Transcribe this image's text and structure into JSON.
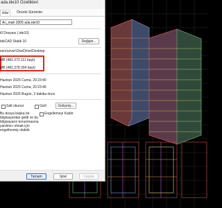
{
  "dialog": {
    "title": "ada.ide10 Özellikleri",
    "tabs": [
      "ıklar",
      "Önceki Sürümler"
    ],
    "file_name": "Ac_mah 3305 ada.ide10",
    "type_value": "i0 Dosyası (.ide10)",
    "opens_with": "ideCAD Statik 10",
    "change_button": "Değiştir...",
    "location": "sers\\urver\\OneDrive\\Desktop",
    "size": "MB (481.372.111 bayt)",
    "size_on_disk": "MB (481.378.304 bayt)",
    "created": "Haziran 2025 Cuma, 20:23:40",
    "modified": "Haziran 2025 Cuma, 20:23:46",
    "accessed": "Haziran 2025 Bugün, 2 dakika önce",
    "attr_readonly": "Salt okunur",
    "attr_hidden": "Gizli",
    "advanced_button": "Gelişmiş...",
    "security_text": [
      "Bu dosya başka bir",
      "bilgisayardan geldi ve bu",
      "bilgisayarın korunmasına",
      "yardımcı olmak için",
      "engellenmiş olabilir."
    ],
    "unblock_label": "Engellemeyi Kaldır",
    "ok_button": "Tamam",
    "cancel_button": "İptal",
    "apply_button": "Uygula"
  },
  "colors": {
    "highlight": "#e0251b",
    "cad_background": "#000000",
    "grid": "#2a2a2a"
  }
}
